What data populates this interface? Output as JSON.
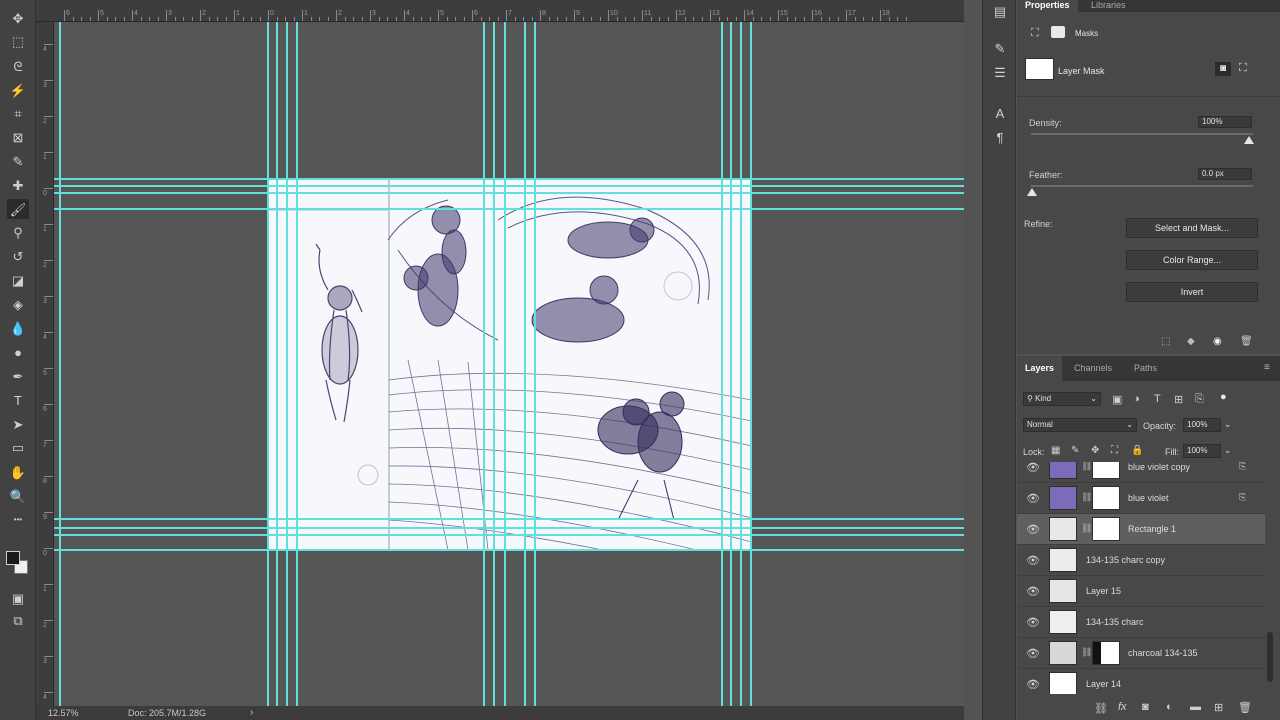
{
  "toolbar": {
    "tools": [
      {
        "icon": "move-icon",
        "glyph": "✥"
      },
      {
        "icon": "marquee-icon",
        "glyph": "⬚"
      },
      {
        "icon": "lasso-icon",
        "glyph": "ᘓ"
      },
      {
        "icon": "magic-wand-icon",
        "glyph": "⚡"
      },
      {
        "icon": "crop-icon",
        "glyph": "⌗"
      },
      {
        "icon": "frame-icon",
        "glyph": "⊠"
      },
      {
        "icon": "eyedropper-icon",
        "glyph": "✎"
      },
      {
        "icon": "healing-brush-icon",
        "glyph": "✚"
      },
      {
        "icon": "brush-icon",
        "glyph": "🖌"
      },
      {
        "icon": "clone-stamp-icon",
        "glyph": "⚲"
      },
      {
        "icon": "history-brush-icon",
        "glyph": "↺"
      },
      {
        "icon": "eraser-icon",
        "glyph": "◪"
      },
      {
        "icon": "paint-bucket-icon",
        "glyph": "◈"
      },
      {
        "icon": "blur-icon",
        "glyph": "💧"
      },
      {
        "icon": "dodge-icon",
        "glyph": "●"
      },
      {
        "icon": "pen-icon",
        "glyph": "✒"
      },
      {
        "icon": "type-icon",
        "glyph": "T"
      },
      {
        "icon": "path-selection-icon",
        "glyph": "➤"
      },
      {
        "icon": "rectangle-icon",
        "glyph": "▭"
      },
      {
        "icon": "hand-icon",
        "glyph": "✋"
      },
      {
        "icon": "zoom-icon",
        "glyph": "🔍"
      },
      {
        "icon": "more-tools-icon",
        "glyph": "•••"
      }
    ]
  },
  "ruler_top": [
    "6",
    "5",
    "4",
    "3",
    "2",
    "1",
    "0",
    "1",
    "2",
    "3",
    "4",
    "5",
    "6",
    "7",
    "8",
    "9",
    "10",
    "11",
    "12",
    "13",
    "14",
    "15",
    "16",
    "17",
    "18"
  ],
  "ruler_left": [
    "4",
    "3",
    "2",
    "1",
    "0",
    "1",
    "2",
    "3",
    "4",
    "5",
    "6",
    "7",
    "8",
    "9",
    "0",
    "1",
    "2",
    "3",
    "4"
  ],
  "status": {
    "zoom": "12.57%",
    "doc": "Doc: 205.7M/1.28G",
    "arrow": "›"
  },
  "properties": {
    "tabs": [
      "Properties",
      "Libraries"
    ],
    "section": "Masks",
    "mask_label": "Layer Mask",
    "density_label": "Density:",
    "density_value": "100%",
    "feather_label": "Feather:",
    "feather_value": "0.0 px",
    "refine_label": "Refine:",
    "buttons": [
      "Select and Mask...",
      "Color Range...",
      "Invert"
    ]
  },
  "layers_panel": {
    "tabs": [
      "Layers",
      "Channels",
      "Paths"
    ],
    "kind": "Kind",
    "blend_mode": "Normal",
    "opacity_label": "Opacity:",
    "opacity_value": "100%",
    "lock_label": "Lock:",
    "fill_label": "Fill:",
    "fill_value": "100%",
    "layers": [
      {
        "name": "blue violet copy",
        "thumb_color": "#7b6bb8",
        "has_mask": true,
        "selected": false
      },
      {
        "name": "blue violet",
        "thumb_color": "#7b6bb8",
        "has_mask": true,
        "selected": false
      },
      {
        "name": "Rectangle 1",
        "thumb_color": "#e8e8e8",
        "has_mask": true,
        "selected": true
      },
      {
        "name": "134-135 charc copy",
        "thumb_color": "#ececec",
        "has_mask": false,
        "selected": false
      },
      {
        "name": "Layer 15",
        "thumb_color": "#e6e6e6",
        "has_mask": false,
        "selected": false
      },
      {
        "name": "134-135 charc",
        "thumb_color": "#eeeeee",
        "has_mask": false,
        "selected": false
      },
      {
        "name": "charcoal 134-135",
        "thumb_color": "#d8d8d8",
        "has_mask": true,
        "selected": false
      },
      {
        "name": "Layer 14",
        "thumb_color": "#ffffff",
        "has_mask": false,
        "selected": false
      }
    ],
    "bottom_icons": [
      "link-icon",
      "fx-icon",
      "mask-icon",
      "adjustment-icon",
      "group-icon",
      "new-layer-icon",
      "trash-icon"
    ]
  }
}
